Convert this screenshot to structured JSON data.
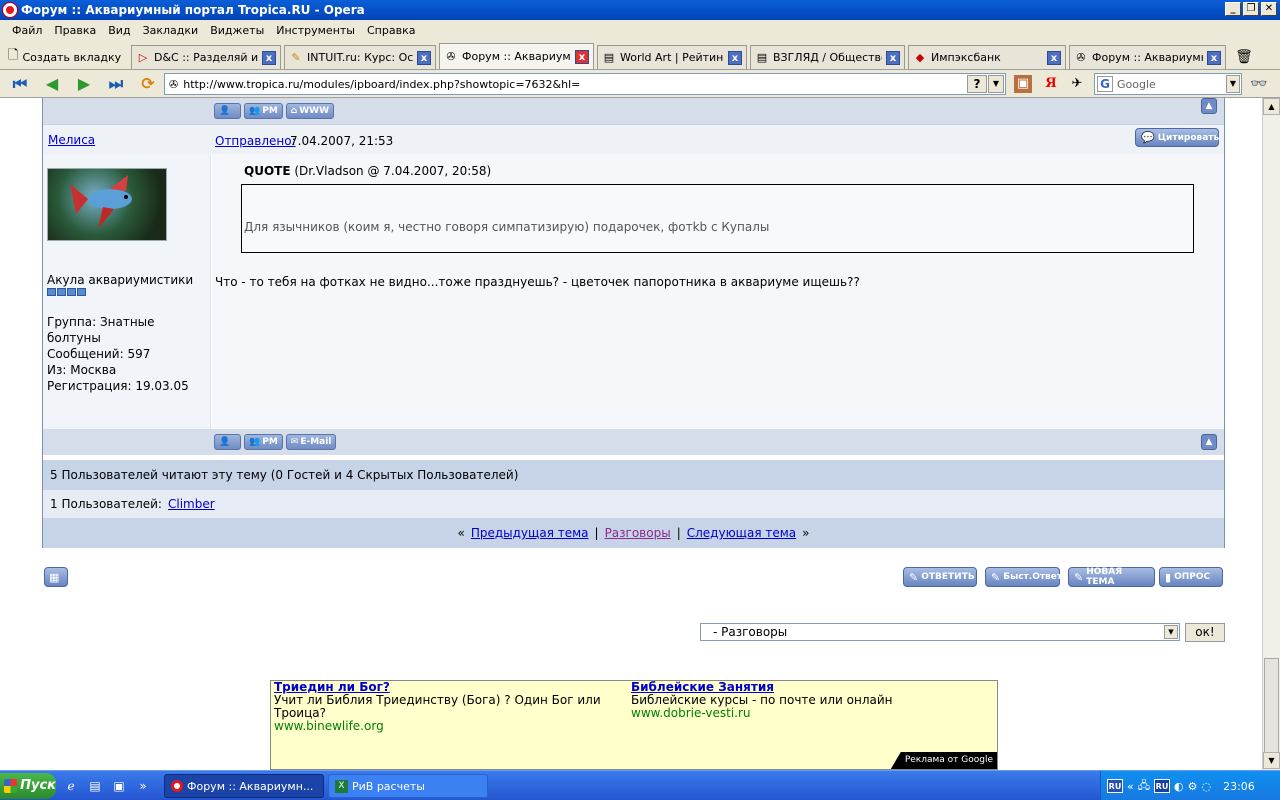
{
  "window": {
    "title": "Форум :: Аквариумный портал Tropica.RU - Opera",
    "btn_min": "_",
    "btn_max": "❐",
    "btn_close": "✕"
  },
  "menu": [
    "Файл",
    "Правка",
    "Вид",
    "Закладки",
    "Виджеты",
    "Инструменты",
    "Справка"
  ],
  "tabs": {
    "new_tab": "Создать вкладку",
    "items": [
      {
        "label": "D&C :: Разделяй и в...",
        "icon": "▷"
      },
      {
        "label": "INTUIT.ru: Курс: Ос...",
        "icon": "✎"
      },
      {
        "label": "Форум :: Аквариумн...",
        "icon": "✇"
      },
      {
        "label": "World Art | Рейтинг ...",
        "icon": "▤"
      },
      {
        "label": "ВЗГЛЯД / Общество",
        "icon": "▤"
      },
      {
        "label": "Импэксбанк",
        "icon": "◆"
      },
      {
        "label": "Форум :: Аквариумн...",
        "icon": "✇"
      }
    ]
  },
  "address": {
    "url": "http://www.tropica.ru/modules/ipboard/index.php?showtopic=7632&hl=",
    "help": "?",
    "search_placeholder": "Google"
  },
  "top_bar": {
    "pm": "PM",
    "www": "WWW"
  },
  "post": {
    "author": "Мелиса",
    "sent_label": "Отправлено:",
    "date": "7.04.2007, 21:53",
    "quote_btn": "Цитировать",
    "user_title": "Акула аквариумистики",
    "group": "Группа: Знатные болтуны",
    "messages": "Сообщений: 597",
    "from": "Из: Москва",
    "registered": "Регистрация: 19.03.05",
    "quote_label": "QUOTE",
    "quote_meta": "(Dr.Vladson @ 7.04.2007, 20:58)",
    "quote_text": "Для язычников (коим я, честно говоря симпатизирую) подарочек, фотkb с Купалы",
    "body": "Что - то тебя на фотках не видно...тоже празднуешь? - цветочек папоротника в аквариуме ищешь??",
    "pm": "PM",
    "email": "E-Mail"
  },
  "readers": {
    "line": "5 Пользователей читают эту тему (0 Гостей и 4 Скрытых Пользователей)",
    "users_label": "1 Пользователей:",
    "user": "Climber"
  },
  "nav": {
    "prev": "Предыдущая тема",
    "forum": "Разговоры",
    "next": "Следующая тема",
    "sep": "|",
    "lq": "«",
    "rq": "»"
  },
  "actions": {
    "reply": "ОТВЕТИТЬ",
    "fast": "Быст.Ответ",
    "new_topic": "НОВАЯ ТЕМА",
    "poll": "ОПРОС"
  },
  "jump": {
    "selected": "- Разговоры",
    "go": "ок!"
  },
  "ads": [
    {
      "title": "Триедин ли Бог?",
      "text": "Учит ли Библия Триединству (Бога) ? Один Бог или Троица?",
      "url": "www.binewlife.org"
    },
    {
      "title": "Библейские Занятия",
      "text": "Библейские курсы - по почте или онлайн",
      "url": "www.dobrie-vesti.ru"
    }
  ],
  "ads_by": "Реклама от Google",
  "taskbar": {
    "start": "Пуск",
    "tasks": [
      "Форум :: Аквариумн...",
      "РиВ расчеты"
    ],
    "lang": "RU",
    "time": "23:06"
  }
}
